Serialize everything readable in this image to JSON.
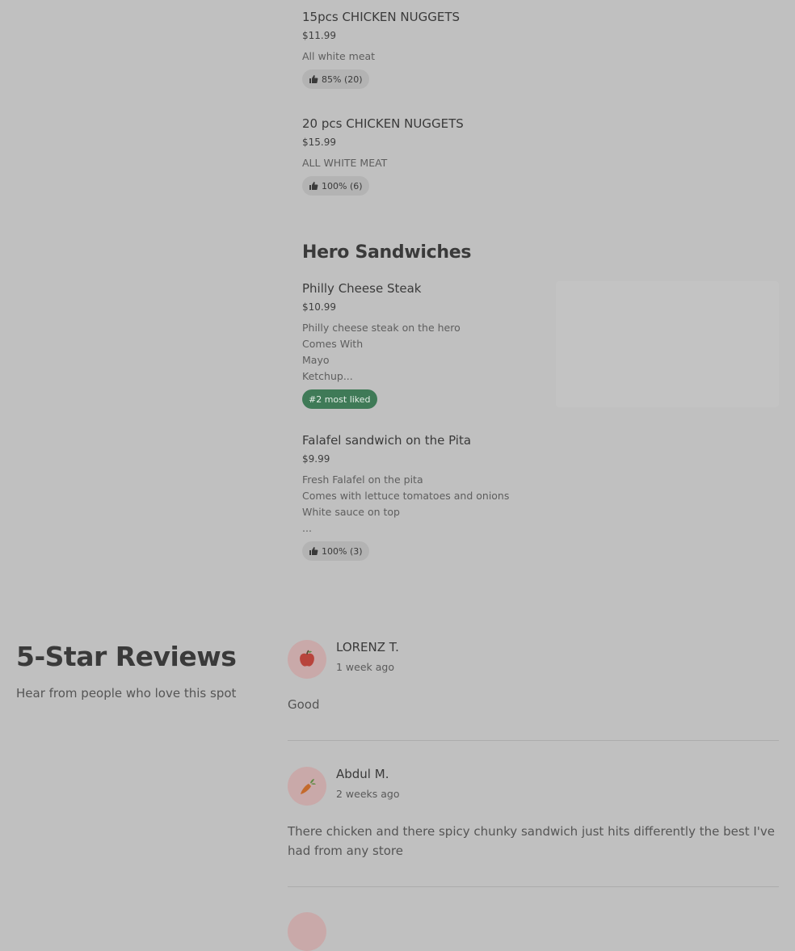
{
  "menu": {
    "items_top": [
      {
        "name": "15pcs CHICKEN NUGGETS",
        "price": "$11.99",
        "desc": "All white meat",
        "rating": "85% (20)"
      },
      {
        "name": "20 pcs CHICKEN NUGGETS",
        "price": "$15.99",
        "desc": "ALL WHITE MEAT",
        "rating": "100% (6)"
      }
    ],
    "section_title": "Hero Sandwiches",
    "items_hero": [
      {
        "name": "Philly Cheese Steak",
        "price": "$10.99",
        "desc": "Philly cheese steak on the hero\nComes With\nMayo\nKetchup...",
        "badge": "#2 most liked"
      },
      {
        "name": "Falafel sandwich on the Pita",
        "price": "$9.99",
        "desc": "Fresh Falafel on the pita\nComes with lettuce tomatoes and onions\nWhite sauce on top\n...",
        "rating": "100% (3)"
      }
    ]
  },
  "reviews": {
    "heading": "5-Star Reviews",
    "subheading": "Hear from people who love this spot",
    "items": [
      {
        "name": "LORENZ T.",
        "date": "1 week ago",
        "text": "Good",
        "avatar_icon": "apple-icon"
      },
      {
        "name": "Abdul M.",
        "date": "2 weeks ago",
        "text": "There chicken and there spicy chunky sandwich just hits differently the best I've had from any store",
        "avatar_icon": "carrot-icon"
      }
    ]
  },
  "colors": {
    "overlay": "#c0c0c0",
    "badge_green": "#3f7a57"
  }
}
